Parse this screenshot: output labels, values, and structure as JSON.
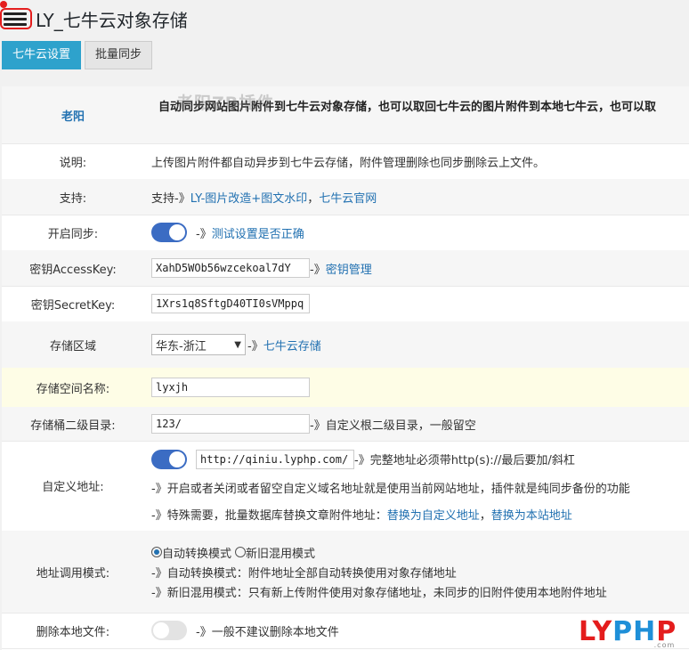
{
  "header": {
    "title": "LY_七牛云对象存储"
  },
  "tabs": [
    {
      "label": "七牛云设置",
      "active": true
    },
    {
      "label": "批量同步",
      "active": false
    }
  ],
  "intro": {
    "author": "老阳",
    "text": "自动同步网站图片附件到七牛云对象存储，也可以取回七牛云的图片附件到本地七牛云，也可以取",
    "watermark": "老阳ZB插件"
  },
  "rows": {
    "desc": {
      "label": "说明:",
      "text": "上传图片附件都自动异步到七牛云存储，附件管理删除也同步删除云上文件。"
    },
    "support": {
      "label": "支持:",
      "prefix": "支持-》",
      "link1": "LY-图片改造+图文水印",
      "sep": "，",
      "link2": "七牛云官网"
    },
    "sync": {
      "label": "开启同步:",
      "enabled": true,
      "prefix": "-》",
      "link": "测试设置是否正确"
    },
    "access": {
      "label": "密钥AccessKey:",
      "value": "XahD5WOb56wzcekoal7dY",
      "prefix": "-》",
      "link": "密钥管理"
    },
    "secret": {
      "label": "密钥SecretKey:",
      "value": "1Xrs1q8SftgD40TI0sVMppq"
    },
    "region": {
      "label": "存储区域",
      "selected": "华东-浙江",
      "prefix": "-》",
      "link": "七牛云存储"
    },
    "bucket": {
      "label": "存储空间名称:",
      "value": "lyxjh"
    },
    "subdir": {
      "label": "存储桶二级目录:",
      "value": "123/",
      "hint": "-》自定义根二级目录，一般留空"
    },
    "domain": {
      "label": "自定义地址:",
      "enabled": true,
      "value": "http://qiniu.lyphp.com/",
      "hint": "-》完整地址必须带http(s)://最后要加/斜杠",
      "line2": "-》开启或者关闭或者留空自定义域名地址就是使用当前网站地址，插件就是纯同步备份的功能",
      "line3_prefix": "-》特殊需要，批量数据库替换文章附件地址：",
      "link1": "替换为自定义地址",
      "sep": "，",
      "link2": "替换为本站地址"
    },
    "mode": {
      "label": "地址调用模式:",
      "option1": "自动转换模式",
      "option2": "新旧混用模式",
      "selected": 1,
      "line1": "-》自动转换模式：附件地址全部自动转换使用对象存储地址",
      "line2": "-》新旧混用模式：只有新上传附件使用对象存储地址，未同步的旧附件使用本地附件地址"
    },
    "delete": {
      "label": "删除本地文件:",
      "enabled": false,
      "hint": "-》一般不建议删除本地文件"
    }
  },
  "logo": {
    "part1": "LY",
    "part2": "PH",
    "part3": "P",
    "sub": ".com"
  },
  "colors": {
    "accent": "#2ea2cc",
    "link": "#2271b1",
    "toggle_on": "#3b6cc3",
    "highlight_row": "#fefde6",
    "logo_red": "#e41d1d",
    "logo_blue": "#1e8fd8"
  }
}
